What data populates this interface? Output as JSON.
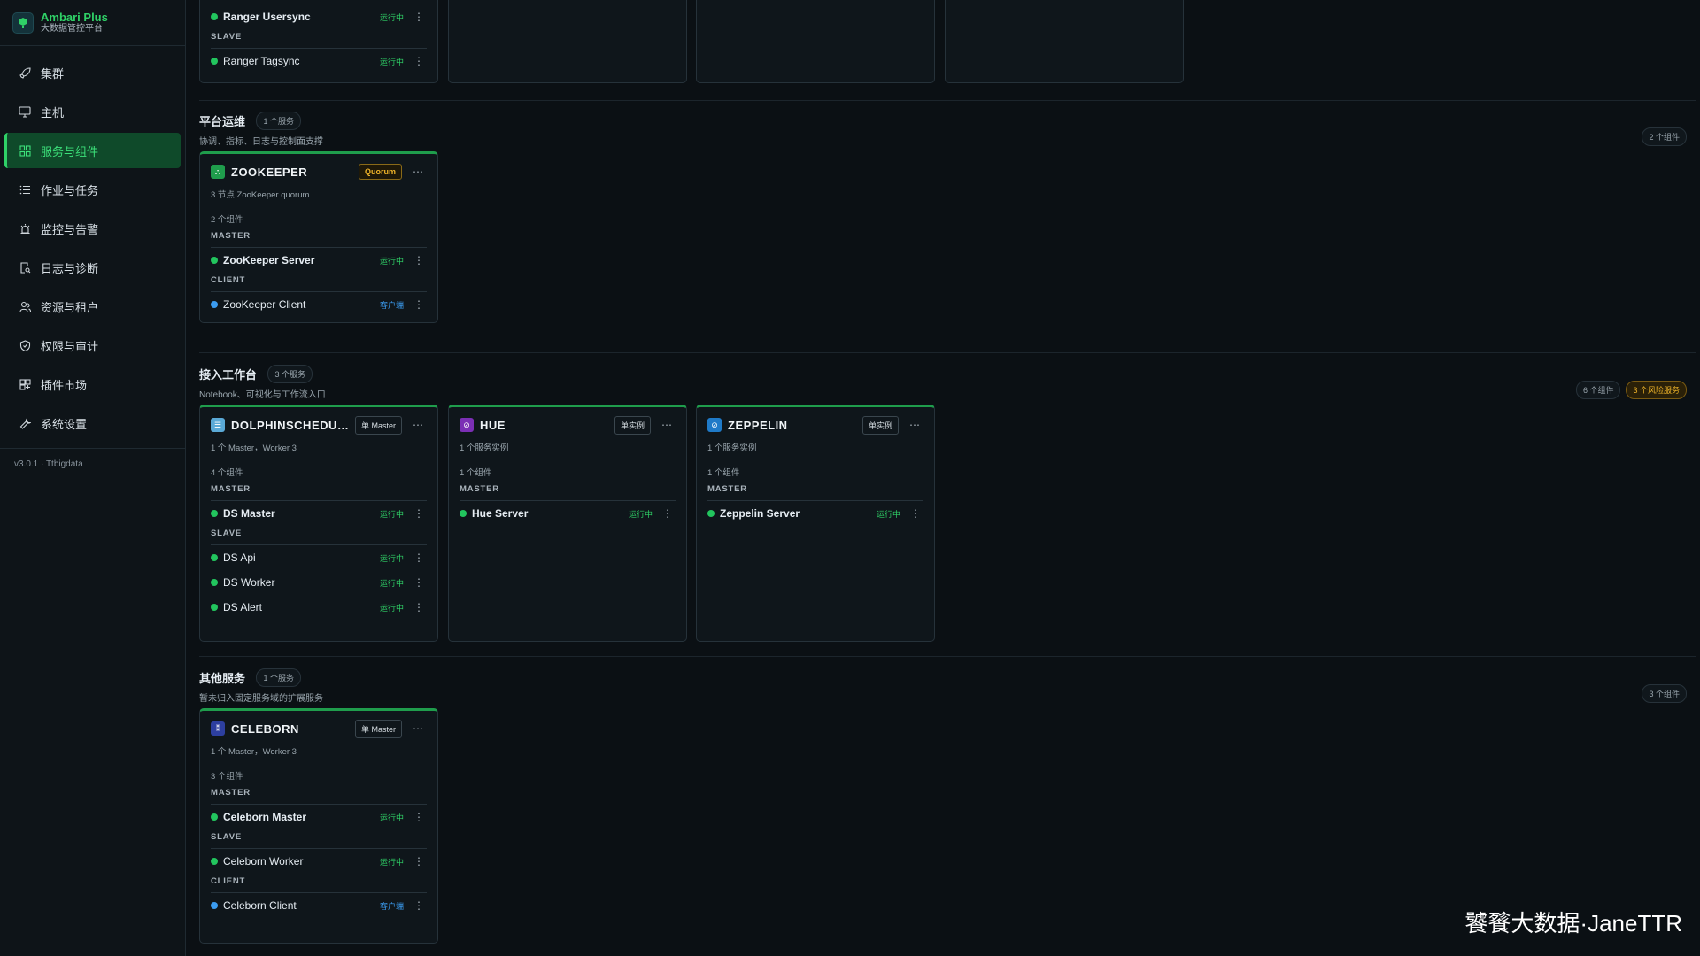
{
  "brand": {
    "title": "Ambari Plus",
    "subtitle": "大数据管控平台"
  },
  "nav": [
    {
      "label": "集群",
      "icon": "rocket-icon"
    },
    {
      "label": "主机",
      "icon": "monitor-icon"
    },
    {
      "label": "服务与组件",
      "icon": "grid-icon",
      "active": true
    },
    {
      "label": "作业与任务",
      "icon": "list-icon"
    },
    {
      "label": "监控与告警",
      "icon": "alarm-icon"
    },
    {
      "label": "日志与诊断",
      "icon": "log-search-icon"
    },
    {
      "label": "资源与租户",
      "icon": "users-icon"
    },
    {
      "label": "权限与审计",
      "icon": "shield-icon"
    },
    {
      "label": "插件市场",
      "icon": "plugin-icon"
    },
    {
      "label": "系统设置",
      "icon": "wrench-icon"
    }
  ],
  "version": "v3.0.1 · Ttbigdata",
  "top_card": {
    "components": [
      {
        "name": "Ranger Usersync",
        "status": "运行中"
      }
    ],
    "slave_label": "SLAVE",
    "slave": {
      "name": "Ranger Tagsync",
      "status": "运行中"
    }
  },
  "sections": {
    "ops": {
      "title": "平台运维",
      "count": "1 个服务",
      "desc": "协调、指标、日志与控制面支撑",
      "right": "2 个组件",
      "zookeeper": {
        "name": "ZOOKEEPER",
        "badge": "Quorum",
        "sub": "3 节点 ZooKeeper quorum",
        "count": "2 个组件",
        "master_label": "MASTER",
        "master": {
          "name": "ZooKeeper Server",
          "status": "运行中"
        },
        "client_label": "CLIENT",
        "client": {
          "name": "ZooKeeper Client",
          "status": "客户端"
        }
      }
    },
    "workbench": {
      "title": "接入工作台",
      "count": "3 个服务",
      "desc": "Notebook、可视化与工作流入口",
      "right": "6 个组件",
      "warn": "3 个风险服务",
      "ds": {
        "name": "DOLPHINSCHEDULER",
        "badge": "单 Master",
        "sub": "1 个 Master，Worker 3",
        "count": "4 个组件",
        "master_label": "MASTER",
        "master": {
          "name": "DS Master",
          "status": "运行中"
        },
        "slave_label": "SLAVE",
        "slaves": [
          {
            "name": "DS Api",
            "status": "运行中"
          },
          {
            "name": "DS Worker",
            "status": "运行中"
          },
          {
            "name": "DS Alert",
            "status": "运行中"
          }
        ]
      },
      "hue": {
        "name": "HUE",
        "badge": "单实例",
        "sub": "1 个服务实例",
        "count": "1 个组件",
        "master_label": "MASTER",
        "master": {
          "name": "Hue Server",
          "status": "运行中"
        }
      },
      "zeppelin": {
        "name": "ZEPPELIN",
        "badge": "单实例",
        "sub": "1 个服务实例",
        "count": "1 个组件",
        "master_label": "MASTER",
        "master": {
          "name": "Zeppelin Server",
          "status": "运行中"
        }
      }
    },
    "other": {
      "title": "其他服务",
      "count": "1 个服务",
      "desc": "暂未归入固定服务域的扩展服务",
      "right": "3 个组件",
      "celeborn": {
        "name": "CELEBORN",
        "badge": "单 Master",
        "sub": "1 个 Master，Worker 3",
        "count": "3 个组件",
        "master_label": "MASTER",
        "master": {
          "name": "Celeborn Master",
          "status": "运行中"
        },
        "slave_label": "SLAVE",
        "slave": {
          "name": "Celeborn Worker",
          "status": "运行中"
        },
        "client_label": "CLIENT",
        "client": {
          "name": "Celeborn Client",
          "status": "客户端"
        }
      }
    }
  },
  "watermark": "饕餮大数据·JaneTTR"
}
